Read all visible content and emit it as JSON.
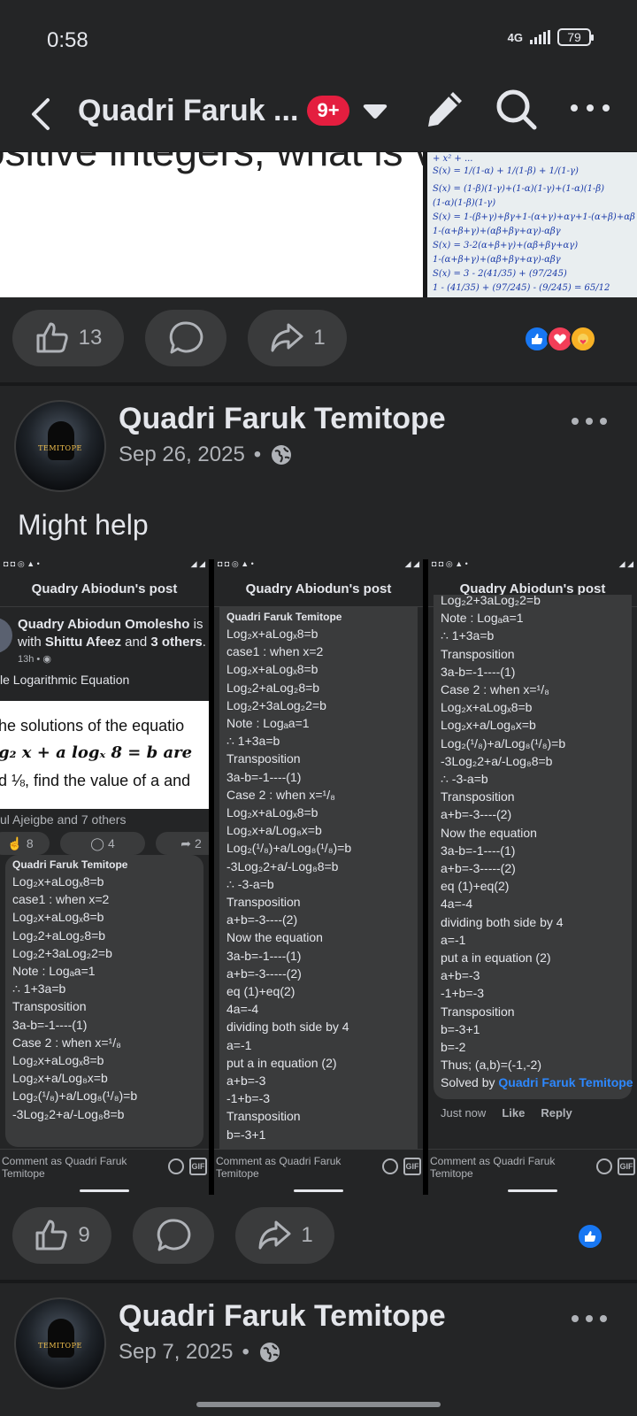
{
  "status_bar": {
    "time": "0:58",
    "network": "4G",
    "battery": "79"
  },
  "top_bar": {
    "title": "Quadri Faruk ...",
    "badge": "9+"
  },
  "prev_media": {
    "image_text": "ositive integers, what is va",
    "handwriting": [
      "+ x² + ...",
      "S(x) = 1/(1-α) + 1/(1-β) + 1/(1-γ)",
      "S(x) = (1-β)(1-γ)+(1-α)(1-γ)+(1-α)(1-β)",
      "(1-α)(1-β)(1-γ)",
      "S(x) = 1-(β+γ)+βγ+1-(α+γ)+αγ+1-(α+β)+αβ",
      "1-(α+β+γ)+(αβ+βγ+αγ)-αβγ",
      "S(x) = 3-2(α+β+γ)+(αβ+βγ+αγ)",
      "1-(α+β+γ)+(αβ+βγ+αγ)-αβγ",
      "S(x) = 3 - 2(41/35) + (97/245)",
      "1 - (41/35) + (97/245) - (9/245) = 65/12"
    ]
  },
  "reaction_bar_1": {
    "like_count": "13",
    "share_count": "1"
  },
  "post": {
    "author": "Quadri Faruk Temitope",
    "date": "Sep 26, 2025",
    "separator": "•",
    "text": "Might help",
    "avatar_text": "TEMITOPE"
  },
  "shots": {
    "header": "Quadry Abiodun's post",
    "comment_as": "Comment as Quadri Faruk Temitope",
    "gif": "GIF",
    "comment_author": "Quadri Faruk Temitope",
    "shot1": {
      "status_left": "◘ ◘ ◎ ▲ •",
      "status_right": "◢ ◢",
      "post_title_name": "Quadry Abiodun Omolesho",
      "post_title_mid": " is with ",
      "post_title_tag": "Shittu Afeez",
      "post_title_and": " and ",
      "post_title_others": "3 others",
      "post_title_end": ".",
      "time": "13h • ◉",
      "eq_title": "le Logarithmic Equation",
      "img_line1": "he solutions of the equatio",
      "img_line2": "g₂ x + a logₓ 8 = b  are",
      "img_line3": "d ⅛, find the value of a and",
      "reactions": "ul Ajeigbe and 7 others",
      "like": "8",
      "comment": "4",
      "share": "2",
      "lines": [
        "Log₂x+aLogₓ8=b",
        "case1 : when x=2",
        "Log₂x+aLogₓ8=b",
        "Log₂2+aLog₂8=b",
        "Log₂2+3aLog₂2=b",
        "Note : Logₐa=1",
        "∴ 1+3a=b",
        "Transposition",
        "3a-b=-1----(1)",
        "Case 2 : when x=¹/₈",
        "Log₂x+aLogₓ8=b",
        "Log₂x+a/Log₈x=b",
        "Log₂(¹/₈)+a/Log₈(¹/₈)=b",
        "-3Log₂2+a/-Log₈8=b"
      ]
    },
    "shot2": {
      "lines": [
        "Log₂x+aLogₓ8=b",
        "case1 : when x=2",
        "Log₂x+aLogₓ8=b",
        "Log₂2+aLog₂8=b",
        "Log₂2+3aLog₂2=b",
        "Note : Logₐa=1",
        "∴ 1+3a=b",
        "Transposition",
        "3a-b=-1----(1)",
        "Case 2 : when x=¹/₈",
        "Log₂x+aLogₓ8=b",
        "Log₂x+a/Log₈x=b",
        "Log₂(¹/₈)+a/Log₈(¹/₈)=b",
        "-3Log₂2+a/-Log₈8=b",
        "∴ -3-a=b",
        "Transposition",
        "a+b=-3----(2)",
        "Now the equation",
        "3a-b=-1----(1)",
        "a+b=-3-----(2)",
        "eq (1)+eq(2)",
        "4a=-4",
        "dividing both side by 4",
        "a=-1",
        "put a in equation (2)",
        "a+b=-3",
        "-1+b=-3",
        "Transposition",
        "b=-3+1"
      ]
    },
    "shot3": {
      "lines": [
        "Log₂2+3aLog₂2=b",
        "Note : Logₐa=1",
        "∴ 1+3a=b",
        "Transposition",
        "3a-b=-1----(1)",
        "Case 2 : when x=¹/₈",
        "Log₂x+aLogₓ8=b",
        "Log₂x+a/Log₈x=b",
        "Log₂(¹/₈)+a/Log₈(¹/₈)=b",
        "-3Log₂2+a/-Log₈8=b",
        "∴ -3-a=b",
        "Transposition",
        "a+b=-3----(2)",
        "Now the equation",
        "3a-b=-1----(1)",
        "a+b=-3-----(2)",
        "eq (1)+eq(2)",
        "4a=-4",
        "dividing both side by 4",
        "a=-1",
        "put a in equation (2)",
        "a+b=-3",
        "-1+b=-3",
        "Transposition",
        "b=-3+1",
        "b=-2",
        "Thus; (a,b)=(-1,-2)"
      ],
      "solved_by": "Solved by ",
      "solved_name": "Quadri Faruk Temitope",
      "meta_time": "Just now",
      "meta_like": "Like",
      "meta_reply": "Reply"
    }
  },
  "reaction_bar_2": {
    "like_count": "9",
    "share_count": "1"
  },
  "post2": {
    "author": "Quadri Faruk Temitope",
    "date": "Sep 7, 2025",
    "separator": "•",
    "avatar_text": "TEMITOPE"
  }
}
